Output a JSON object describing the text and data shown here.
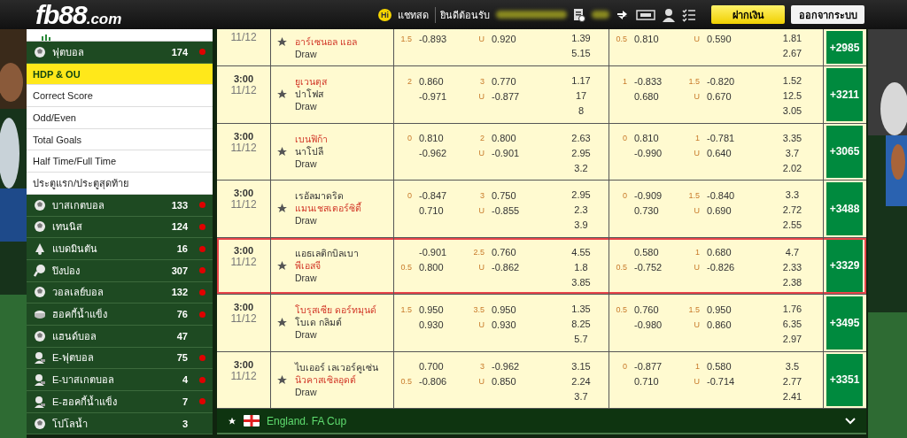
{
  "header": {
    "logo": "fb88",
    "logo_suffix": ".com",
    "chat_badge": "Hi",
    "chat_label": "แชทสด",
    "welcome": "ยินดีต้อนรับ",
    "deposit_button": "ฝากเงิน",
    "logout_button": "ออกจากระบบ"
  },
  "sidebar": {
    "items": [
      {
        "kind": "ball",
        "label": "ฟุตบอล",
        "count": "174",
        "live": true,
        "expanded": true,
        "children": [
          {
            "label": "HDP & OU",
            "selected": true
          },
          {
            "label": "Correct Score",
            "selected": false
          },
          {
            "label": "Odd/Even",
            "selected": false
          },
          {
            "label": "Total Goals",
            "selected": false
          },
          {
            "label": "Half Time/Full Time",
            "selected": false
          },
          {
            "label": "ประตูแรก/ประตูสุดท้าย",
            "selected": false
          }
        ]
      },
      {
        "kind": "ball",
        "label": "บาสเกตบอล",
        "count": "133",
        "live": true
      },
      {
        "kind": "ball",
        "label": "เทนนิส",
        "count": "124",
        "live": true
      },
      {
        "kind": "shuttlecock",
        "label": "แบดมินตัน",
        "count": "16",
        "live": true
      },
      {
        "kind": "paddle",
        "label": "ปิงปอง",
        "count": "307",
        "live": true
      },
      {
        "kind": "ball",
        "label": "วอลเลย์บอล",
        "count": "132",
        "live": true
      },
      {
        "kind": "puck",
        "label": "ฮอคกี้น้ำแข็ง",
        "count": "76",
        "live": true
      },
      {
        "kind": "ball",
        "label": "แฮนด์บอล",
        "count": "47",
        "live": false
      },
      {
        "kind": "gamer",
        "label": "E-ฟุตบอล",
        "count": "75",
        "live": true
      },
      {
        "kind": "gamer",
        "label": "E-บาสเกตบอล",
        "count": "4",
        "live": true
      },
      {
        "kind": "gamer",
        "label": "E-ฮอคกี้น้ำแข็ง",
        "count": "7",
        "live": true
      },
      {
        "kind": "ball",
        "label": "โปโลน้ำ",
        "count": "3",
        "live": false
      }
    ]
  },
  "matches": [
    {
      "date": "11/12",
      "teams": [
        {
          "name": "อาร์เซนอล แอล",
          "favorite": true
        }
      ],
      "draw": "Draw",
      "ft": {
        "hdp": [
          {
            "line": "1.5",
            "odds": "-0.893"
          }
        ],
        "ou": [
          {
            "line": "U",
            "odds": "0.920"
          }
        ],
        "x12": [
          "1.39",
          "5.15"
        ]
      },
      "fh": {
        "hdp": [
          {
            "line": "0.5",
            "odds": "0.810"
          }
        ],
        "ou": [
          {
            "line": "U",
            "odds": "0.590"
          }
        ],
        "x12": [
          "1.81",
          "2.67"
        ]
      },
      "more": "+2985",
      "selected": false
    },
    {
      "time": "3:00",
      "date": "11/12",
      "teams": [
        {
          "name": "ยูเวนตุส",
          "favorite": true
        },
        {
          "name": "ปาโฟส",
          "favorite": false
        }
      ],
      "draw": "Draw",
      "ft": {
        "hdp": [
          {
            "line": "2",
            "odds": "0.860"
          },
          {
            "odds": "-0.971"
          }
        ],
        "ou": [
          {
            "line": "3",
            "odds": "0.770"
          },
          {
            "line": "U",
            "odds": "-0.877"
          }
        ],
        "x12": [
          "1.17",
          "17",
          "8"
        ]
      },
      "fh": {
        "hdp": [
          {
            "line": "1",
            "odds": "-0.833"
          },
          {
            "odds": "0.680"
          }
        ],
        "ou": [
          {
            "line": "1.5",
            "odds": "-0.820"
          },
          {
            "line": "U",
            "odds": "0.670"
          }
        ],
        "x12": [
          "1.52",
          "12.5",
          "3.05"
        ]
      },
      "more": "+3211",
      "selected": false
    },
    {
      "time": "3:00",
      "date": "11/12",
      "teams": [
        {
          "name": "เบนฟิก้า",
          "favorite": true
        },
        {
          "name": "นาโปลี",
          "favorite": false
        }
      ],
      "draw": "Draw",
      "ft": {
        "hdp": [
          {
            "line": "0",
            "odds": "0.810"
          },
          {
            "odds": "-0.962"
          }
        ],
        "ou": [
          {
            "line": "2",
            "odds": "0.800"
          },
          {
            "line": "U",
            "odds": "-0.901"
          }
        ],
        "x12": [
          "2.63",
          "2.95",
          "3.2"
        ]
      },
      "fh": {
        "hdp": [
          {
            "line": "0",
            "odds": "0.810"
          },
          {
            "odds": "-0.990"
          }
        ],
        "ou": [
          {
            "line": "1",
            "odds": "-0.781"
          },
          {
            "line": "U",
            "odds": "0.640"
          }
        ],
        "x12": [
          "3.35",
          "3.7",
          "2.02"
        ]
      },
      "more": "+3065",
      "selected": false
    },
    {
      "time": "3:00",
      "date": "11/12",
      "teams": [
        {
          "name": "เรอัลมาดริด",
          "favorite": false
        },
        {
          "name": "แมนเชสเตอร์ซิตี้",
          "favorite": true
        }
      ],
      "draw": "Draw",
      "ft": {
        "hdp": [
          {
            "line": "0",
            "odds": "-0.847"
          },
          {
            "odds": "0.710"
          }
        ],
        "ou": [
          {
            "line": "3",
            "odds": "0.750"
          },
          {
            "line": "U",
            "odds": "-0.855"
          }
        ],
        "x12": [
          "2.95",
          "2.3",
          "3.9"
        ]
      },
      "fh": {
        "hdp": [
          {
            "line": "0",
            "odds": "-0.909"
          },
          {
            "odds": "0.730"
          }
        ],
        "ou": [
          {
            "line": "1.5",
            "odds": "-0.840"
          },
          {
            "line": "U",
            "odds": "0.690"
          }
        ],
        "x12": [
          "3.3",
          "2.72",
          "2.55"
        ]
      },
      "more": "+3488",
      "selected": false
    },
    {
      "time": "3:00",
      "date": "11/12",
      "teams": [
        {
          "name": "แอธเลติกบิลเบา",
          "favorite": false
        },
        {
          "name": "พีเอสจี",
          "favorite": true
        }
      ],
      "draw": "Draw",
      "ft": {
        "hdp": [
          {
            "odds": "-0.901"
          },
          {
            "line": "0.5",
            "odds": "0.800"
          }
        ],
        "ou": [
          {
            "line": "2.5",
            "odds": "0.760"
          },
          {
            "line": "U",
            "odds": "-0.862"
          }
        ],
        "x12": [
          "4.55",
          "1.8",
          "3.85"
        ]
      },
      "fh": {
        "hdp": [
          {
            "odds": "0.580"
          },
          {
            "line": "0.5",
            "odds": "-0.752"
          }
        ],
        "ou": [
          {
            "line": "1",
            "odds": "0.680"
          },
          {
            "line": "U",
            "odds": "-0.826"
          }
        ],
        "x12": [
          "4.7",
          "2.33",
          "2.38"
        ]
      },
      "more": "+3329",
      "selected": true
    },
    {
      "time": "3:00",
      "date": "11/12",
      "teams": [
        {
          "name": "โบรุสเซีย ดอร์ทมุนด์",
          "favorite": true
        },
        {
          "name": "โบเด กลิมต์",
          "favorite": false
        }
      ],
      "draw": "Draw",
      "ft": {
        "hdp": [
          {
            "line": "1.5",
            "odds": "0.950"
          },
          {
            "odds": "0.930"
          }
        ],
        "ou": [
          {
            "line": "3.5",
            "odds": "0.950"
          },
          {
            "line": "U",
            "odds": "0.930"
          }
        ],
        "x12": [
          "1.35",
          "8.25",
          "5.7"
        ]
      },
      "fh": {
        "hdp": [
          {
            "line": "0.5",
            "odds": "0.760"
          },
          {
            "odds": "-0.980"
          }
        ],
        "ou": [
          {
            "line": "1.5",
            "odds": "0.950"
          },
          {
            "line": "U",
            "odds": "0.860"
          }
        ],
        "x12": [
          "1.76",
          "6.35",
          "2.97"
        ]
      },
      "more": "+3495",
      "selected": false
    },
    {
      "time": "3:00",
      "date": "11/12",
      "teams": [
        {
          "name": "ไบเออร์ เลเวอร์คูเซ่น",
          "favorite": false
        },
        {
          "name": "นิวคาสเซิลอุดต์",
          "favorite": true
        }
      ],
      "draw": "Draw",
      "ft": {
        "hdp": [
          {
            "odds": "0.700"
          },
          {
            "line": "0.5",
            "odds": "-0.806"
          }
        ],
        "ou": [
          {
            "line": "3",
            "odds": "-0.962"
          },
          {
            "line": "U",
            "odds": "0.850"
          }
        ],
        "x12": [
          "3.15",
          "2.24",
          "3.7"
        ]
      },
      "fh": {
        "hdp": [
          {
            "line": "0",
            "odds": "-0.877"
          },
          {
            "odds": "0.710"
          }
        ],
        "ou": [
          {
            "line": "1",
            "odds": "0.580"
          },
          {
            "line": "U",
            "odds": "-0.714"
          }
        ],
        "x12": [
          "3.5",
          "2.77",
          "2.41"
        ]
      },
      "more": "+3351",
      "selected": false
    }
  ],
  "league": {
    "name": "England. FA Cup"
  }
}
